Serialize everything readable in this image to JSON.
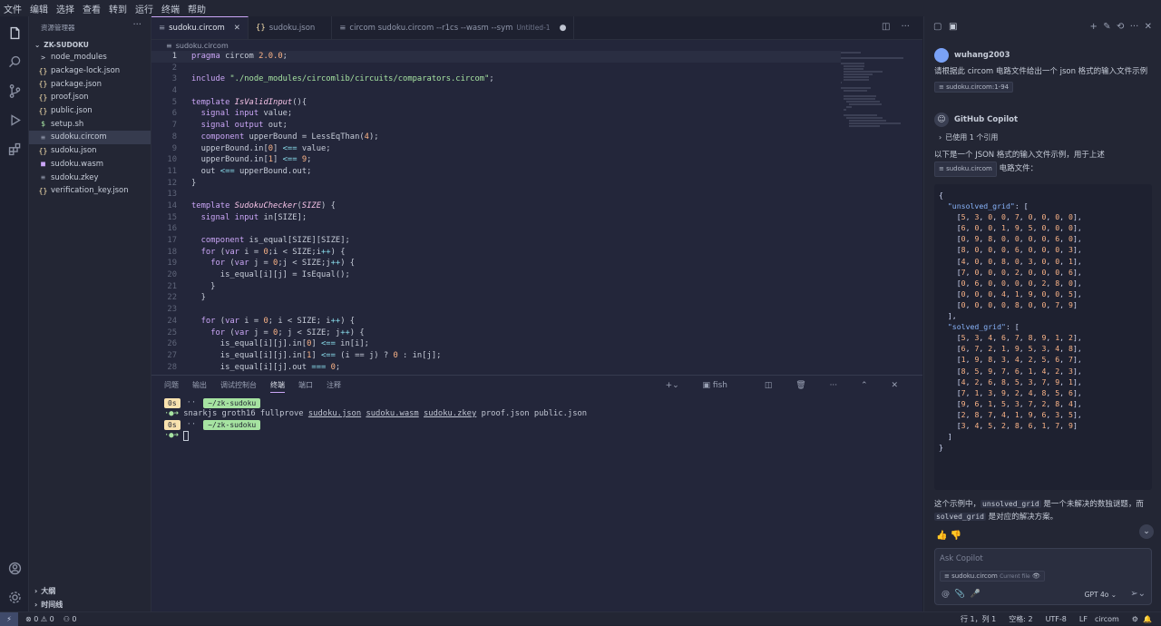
{
  "menu": [
    "文件",
    "编辑",
    "选择",
    "查看",
    "转到",
    "运行",
    "终端",
    "帮助"
  ],
  "sidebar": {
    "title": "资源管理器",
    "folder": "ZK-SUDOKU",
    "files": [
      {
        "icon": ">",
        "name": "node_modules",
        "color": "#c6ccd8"
      },
      {
        "icon": "{}",
        "name": "package-lock.json",
        "color": "#f9e2af"
      },
      {
        "icon": "{}",
        "name": "package.json",
        "color": "#f9e2af"
      },
      {
        "icon": "{}",
        "name": "proof.json",
        "color": "#f9e2af"
      },
      {
        "icon": "{}",
        "name": "public.json",
        "color": "#f9e2af"
      },
      {
        "icon": "$",
        "name": "setup.sh",
        "color": "#a6e3a1"
      },
      {
        "icon": "≡",
        "name": "sudoku.circom",
        "color": "#9aa1b4"
      },
      {
        "icon": "{}",
        "name": "sudoku.json",
        "color": "#f9e2af"
      },
      {
        "icon": "■",
        "name": "sudoku.wasm",
        "color": "#cba6f7"
      },
      {
        "icon": "≡",
        "name": "sudoku.zkey",
        "color": "#9aa1b4"
      },
      {
        "icon": "{}",
        "name": "verification_key.json",
        "color": "#f9e2af"
      }
    ],
    "outline": "大纲",
    "timeline": "时间线"
  },
  "tabs": [
    {
      "label": "sudoku.circom",
      "active": true
    },
    {
      "label": "sudoku.json",
      "active": false
    },
    {
      "label": "circom sudoku.circom --r1cs --wasm --sym",
      "sub": "Untitled-1",
      "active": false
    }
  ],
  "breadcrumb": "sudoku.circom",
  "code_lines": [
    "pragma circom 2.0.0;",
    "",
    "include \"./node_modules/circomlib/circuits/comparators.circom\";",
    "",
    "template IsValidInput(){",
    "  signal input value;",
    "  signal output out;",
    "  component upperBound = LessEqThan(4);",
    "  upperBound.in[0] <== value;",
    "  upperBound.in[1] <== 9;",
    "  out <== upperBound.out;",
    "}",
    "",
    "template SudokuChecker(SIZE) {",
    "  signal input in[SIZE];",
    "",
    "  component is_equal[SIZE][SIZE];",
    "  for (var i = 0;i < SIZE;i++) {",
    "    for (var j = 0;j < SIZE;j++) {",
    "      is_equal[i][j] = IsEqual();",
    "    }",
    "  }",
    "",
    "  for (var i = 0; i < SIZE; i++) {",
    "    for (var j = 0; j < SIZE; j++) {",
    "      is_equal[i][j].in[0] <== in[i];",
    "      is_equal[i][j].in[1] <== (i == j) ? 0 : in[j];",
    "      is_equal[i][j].out === 0;"
  ],
  "panel": {
    "tabs": [
      "问题",
      "输出",
      "调试控制台",
      "终端",
      "端口",
      "注释"
    ],
    "active_tab": "终端",
    "shell": "fish",
    "time_badge": "0s",
    "dir_badge": "~/zk-sudoku",
    "command_prefix": "snarkjs groth16 fullprove",
    "command_args_underlined": [
      "sudoku.json",
      "sudoku.wasm",
      "sudoku.zkey"
    ],
    "command_args": [
      "proof.json",
      "public.json"
    ]
  },
  "chat": {
    "user": "wuhang2003",
    "question": "请根据此 circom 电路文件给出一个 json 格式的输入文件示例",
    "question_ref": "sudoku.circom:1-94",
    "assistant": "GitHub Copilot",
    "refs": "已使用 1 个引用",
    "intro_a": "以下是一个 JSON 格式的输入文件示例，用于上述",
    "intro_file": "sudoku.circom",
    "intro_b": "电路文件：",
    "unsolved_key": "\"unsolved_grid\"",
    "solved_key": "\"solved_grid\"",
    "unsolved_grid": [
      [
        5,
        3,
        0,
        0,
        7,
        0,
        0,
        0,
        0
      ],
      [
        6,
        0,
        0,
        1,
        9,
        5,
        0,
        0,
        0
      ],
      [
        0,
        9,
        8,
        0,
        0,
        0,
        0,
        6,
        0
      ],
      [
        8,
        0,
        0,
        0,
        6,
        0,
        0,
        0,
        3
      ],
      [
        4,
        0,
        0,
        8,
        0,
        3,
        0,
        0,
        1
      ],
      [
        7,
        0,
        0,
        0,
        2,
        0,
        0,
        0,
        6
      ],
      [
        0,
        6,
        0,
        0,
        0,
        0,
        2,
        8,
        0
      ],
      [
        0,
        0,
        0,
        4,
        1,
        9,
        0,
        0,
        5
      ],
      [
        0,
        0,
        0,
        0,
        8,
        0,
        0,
        7,
        9
      ]
    ],
    "solved_grid": [
      [
        5,
        3,
        4,
        6,
        7,
        8,
        9,
        1,
        2
      ],
      [
        6,
        7,
        2,
        1,
        9,
        5,
        3,
        4,
        8
      ],
      [
        1,
        9,
        8,
        3,
        4,
        2,
        5,
        6,
        7
      ],
      [
        8,
        5,
        9,
        7,
        6,
        1,
        4,
        2,
        3
      ],
      [
        4,
        2,
        6,
        8,
        5,
        3,
        7,
        9,
        1
      ],
      [
        7,
        1,
        3,
        9,
        2,
        4,
        8,
        5,
        6
      ],
      [
        9,
        6,
        1,
        5,
        3,
        7,
        2,
        8,
        4
      ],
      [
        2,
        8,
        7,
        4,
        1,
        9,
        6,
        3,
        5
      ],
      [
        3,
        4,
        5,
        2,
        8,
        6,
        1,
        7,
        9
      ]
    ],
    "expl_a": "这个示例中，",
    "expl_code1": "unsolved_grid",
    "expl_b": " 是一个未解决的数独谜题，而",
    "expl_code2": "solved_grid",
    "expl_c": " 是对应的解决方案。",
    "ask_placeholder": "Ask Copilot",
    "context_file": "sudoku.circom",
    "context_label": "Current file",
    "model": "GPT 4o"
  },
  "status": {
    "errors": "0",
    "warnings": "0",
    "ports": "0",
    "position": "行 1，列 1",
    "spaces": "空格: 2",
    "encoding": "UTF-8",
    "eol": "LF",
    "language": "circom"
  }
}
